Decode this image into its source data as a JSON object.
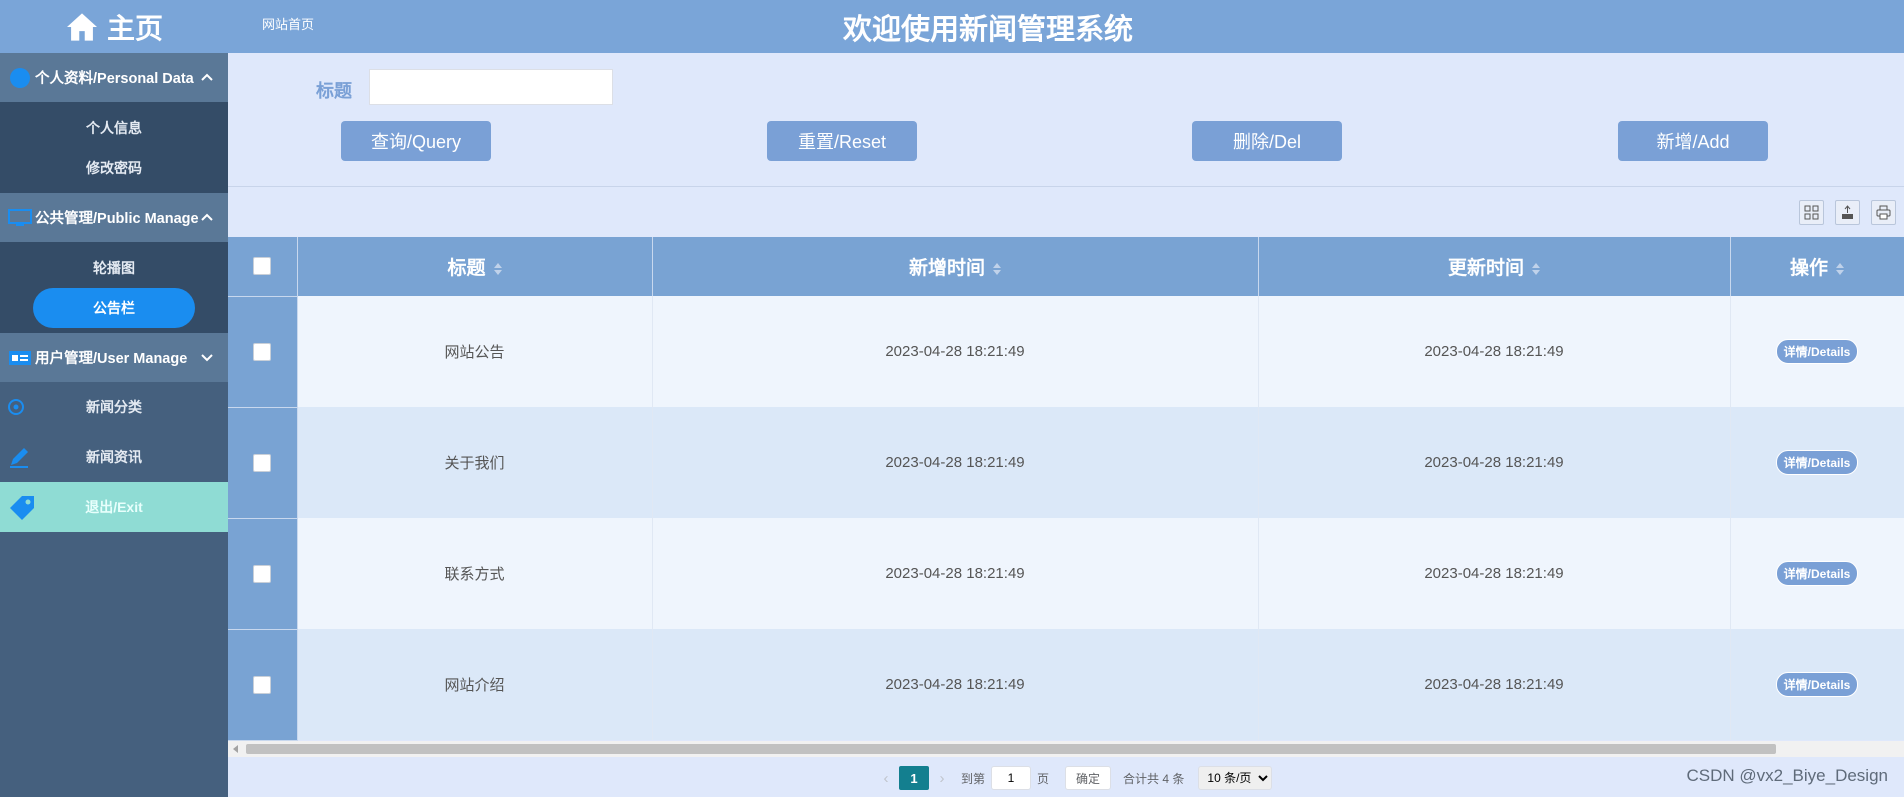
{
  "sidebar": {
    "brand": "主页",
    "sections": [
      {
        "label": "个人资料/Personal Data",
        "items": [
          "个人信息",
          "修改密码"
        ]
      },
      {
        "label": "公共管理/Public Manage",
        "items": [
          "轮播图",
          "公告栏"
        ]
      },
      {
        "label": "用户管理/User Manage"
      }
    ],
    "plain_items": [
      "新闻分类",
      "新闻资讯"
    ],
    "exit": "退出/Exit"
  },
  "header": {
    "breadcrumb": "网站首页",
    "title": "欢迎使用新闻管理系统"
  },
  "search": {
    "title_label": "标题",
    "title_value": "",
    "buttons": {
      "query": "查询/Query",
      "reset": "重置/Reset",
      "delete": "删除/Del",
      "add": "新增/Add"
    }
  },
  "table": {
    "columns": [
      "标题",
      "新增时间",
      "更新时间",
      "操作"
    ],
    "rows": [
      {
        "title": "网站公告",
        "created": "2023-04-28 18:21:49",
        "updated": "2023-04-28 18:21:49",
        "action": "详情/Details"
      },
      {
        "title": "关于我们",
        "created": "2023-04-28 18:21:49",
        "updated": "2023-04-28 18:21:49",
        "action": "详情/Details"
      },
      {
        "title": "联系方式",
        "created": "2023-04-28 18:21:49",
        "updated": "2023-04-28 18:21:49",
        "action": "详情/Details"
      },
      {
        "title": "网站介绍",
        "created": "2023-04-28 18:21:49",
        "updated": "2023-04-28 18:21:49",
        "action": "详情/Details"
      }
    ]
  },
  "pager": {
    "current": "1",
    "goto_label": "到第",
    "goto_value": "1",
    "page_unit": "页",
    "confirm": "确定",
    "total": "合计共 4 条",
    "page_size": "10 条/页"
  },
  "watermark": "CSDN @vx2_Biye_Design",
  "colors": {
    "accent": "#7aa0d6",
    "sidebar": "#45607e",
    "active": "#1a8df0",
    "pager_active": "#137f8f"
  }
}
